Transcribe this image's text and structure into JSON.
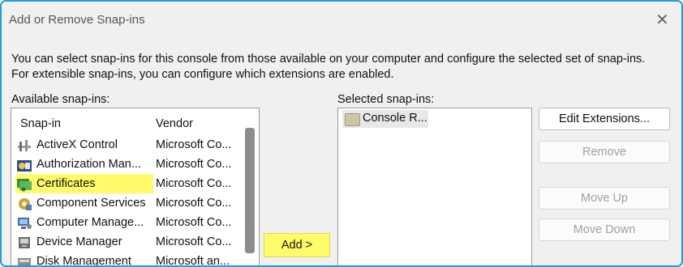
{
  "window": {
    "title": "Add or Remove Snap-ins"
  },
  "description": {
    "line1": "You can select snap-ins for this console from those available on your computer and configure the selected set of snap-ins.",
    "line2": "For extensible snap-ins, you can configure which extensions are enabled."
  },
  "available": {
    "label": "Available snap-ins:",
    "columns": {
      "snapin": "Snap-in",
      "vendor": "Vendor"
    },
    "items": [
      {
        "name": "ActiveX Control",
        "vendor": "Microsoft Co...",
        "icon": "activex-icon"
      },
      {
        "name": "Authorization Man...",
        "vendor": "Microsoft Co...",
        "icon": "authorization-icon"
      },
      {
        "name": "Certificates",
        "vendor": "Microsoft Co...",
        "icon": "certificates-icon",
        "highlighted": true
      },
      {
        "name": "Component Services",
        "vendor": "Microsoft Co...",
        "icon": "component-services-icon"
      },
      {
        "name": "Computer Manage...",
        "vendor": "Microsoft Co...",
        "icon": "computer-management-icon"
      },
      {
        "name": "Device Manager",
        "vendor": "Microsoft Co...",
        "icon": "device-manager-icon"
      },
      {
        "name": "Disk Management",
        "vendor": "Microsoft an...",
        "icon": "disk-management-icon"
      }
    ]
  },
  "add_button": "Add >",
  "selected": {
    "label": "Selected snap-ins:",
    "items": [
      {
        "name": "Console R...",
        "icon": "folder-icon"
      }
    ]
  },
  "buttons": {
    "edit_extensions": "Edit Extensions...",
    "remove": "Remove",
    "move_up": "Move Up",
    "move_down": "Move Down"
  },
  "colors": {
    "highlight": "#fffb6a",
    "border_accent": "#1f9ed8"
  }
}
